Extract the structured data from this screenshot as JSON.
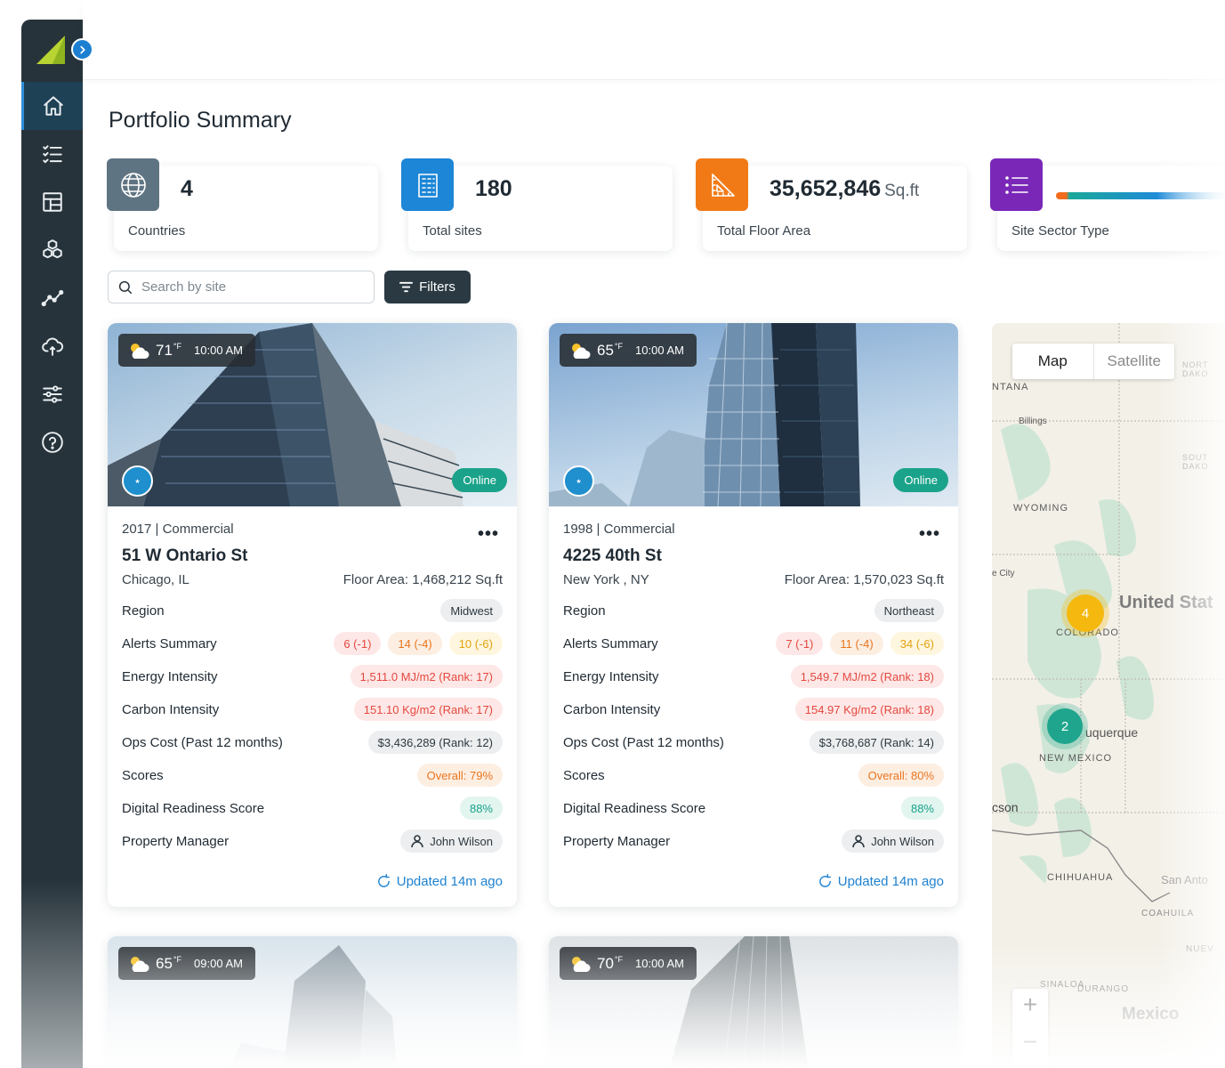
{
  "page": {
    "title": "Portfolio Summary"
  },
  "kpis": [
    {
      "value": "4",
      "unit": "",
      "label": "Countries",
      "icon": "globe-icon",
      "color": "#5f7482"
    },
    {
      "value": "180",
      "unit": "",
      "label": "Total sites",
      "icon": "building-icon",
      "color": "#1d86d6"
    },
    {
      "value": "35,652,846",
      "unit": "Sq.ft",
      "label": "Total Floor Area",
      "icon": "ruler-triangle-icon",
      "color": "#f27a16"
    },
    {
      "value": "",
      "unit": "",
      "label": "Site Sector Type",
      "icon": "list-icon",
      "color": "#7a27b8"
    }
  ],
  "search": {
    "placeholder": "Search by site"
  },
  "filters": {
    "label": "Filters"
  },
  "sites": [
    {
      "temp": "71",
      "temp_unit": "°F",
      "time": "10:00 AM",
      "status": "Online",
      "year_type": "2017 | Commercial",
      "name": "51 W Ontario St",
      "city": "Chicago, IL",
      "floor_area": "Floor Area: 1,468,212 Sq.ft",
      "region_label": "Region",
      "region": "Midwest",
      "alerts_label": "Alerts Summary",
      "alerts": [
        "6 (-1)",
        "14 (-4)",
        "10 (-6)"
      ],
      "energy_label": "Energy Intensity",
      "energy": "1,511.0 MJ/m2 (Rank: 17)",
      "carbon_label": "Carbon Intensity",
      "carbon": "151.10 Kg/m2 (Rank: 17)",
      "ops_label": "Ops Cost (Past 12 months)",
      "ops": "$3,436,289 (Rank: 12)",
      "scores_label": "Scores",
      "scores": "Overall: 79%",
      "digital_label": "Digital Readiness Score",
      "digital": "88%",
      "manager_label": "Property Manager",
      "manager": "John Wilson",
      "updated": "Updated 14m ago"
    },
    {
      "temp": "65",
      "temp_unit": "°F",
      "time": "10:00 AM",
      "status": "Online",
      "year_type": "1998 | Commercial",
      "name": "4225 40th St",
      "city": "New York , NY",
      "floor_area": "Floor Area: 1,570,023 Sq.ft",
      "region_label": "Region",
      "region": "Northeast",
      "alerts_label": "Alerts Summary",
      "alerts": [
        "7 (-1)",
        "11 (-4)",
        "34 (-6)"
      ],
      "energy_label": "Energy Intensity",
      "energy": "1,549.7 MJ/m2 (Rank: 18)",
      "carbon_label": "Carbon Intensity",
      "carbon": "154.97 Kg/m2 (Rank: 18)",
      "ops_label": "Ops Cost (Past 12 months)",
      "ops": "$3,768,687 (Rank: 14)",
      "scores_label": "Scores",
      "scores": "Overall: 80%",
      "digital_label": "Digital Readiness Score",
      "digital": "88%",
      "manager_label": "Property Manager",
      "manager": "John Wilson",
      "updated": "Updated 14m ago"
    },
    {
      "temp": "65",
      "temp_unit": "°F",
      "time": "09:00 AM"
    },
    {
      "temp": "70",
      "temp_unit": "°F",
      "time": "10:00 AM"
    }
  ],
  "map": {
    "tab_map": "Map",
    "tab_satellite": "Satellite",
    "labels": [
      "NTANA",
      "Billings",
      "WYOMING",
      "United Stat",
      "COLORADO",
      "NEW MEXICO",
      "uquerque",
      "CHIHUAHUA",
      "COAHUILA",
      "SINALOA",
      "DURANGO",
      "Mexico",
      "San Anto",
      "NORT DAKO",
      "SOUT DAKO",
      "e City",
      "cson",
      "NUEV"
    ],
    "clusters": [
      {
        "count": "4",
        "color": "#f5b80f"
      },
      {
        "count": "2",
        "color": "#1fa58d"
      }
    ]
  }
}
